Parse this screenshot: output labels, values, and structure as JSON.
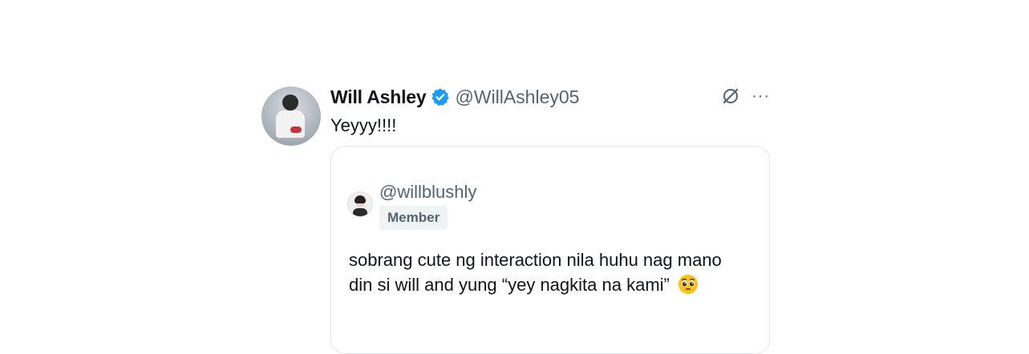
{
  "tweet": {
    "author_name": "Will Ashley",
    "author_handle": "@WillAshley05",
    "text": "Yeyyy!!!!",
    "more_label": "···"
  },
  "quote": {
    "handle": "@willblushly",
    "badge": "Member",
    "text": "sobrang cute ng interaction nila huhu nag mano din si will and yung “yey nagkita na kami”"
  },
  "colors": {
    "verified": "#1d9bf0",
    "secondary_text": "#536471",
    "border": "#e3e7ea"
  }
}
